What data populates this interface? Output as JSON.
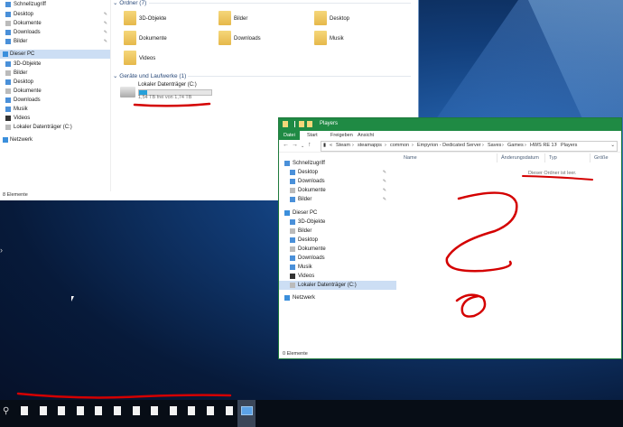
{
  "window1": {
    "nav": {
      "quick_access": "Schnellzugriff",
      "quick_items": [
        "Desktop",
        "Dokumente",
        "Downloads",
        "Bilder"
      ],
      "this_pc": "Dieser PC",
      "pc_items": [
        "3D-Objekte",
        "Bilder",
        "Desktop",
        "Dokumente",
        "Downloads",
        "Musik",
        "Videos",
        "Lokaler Datenträger (C:)"
      ],
      "network": "Netzwerk"
    },
    "folders_header": "Ordner (7)",
    "folders": [
      "3D-Objekte",
      "Bilder",
      "Desktop",
      "Dokumente",
      "Downloads",
      "Musik",
      "Videos"
    ],
    "drives_header": "Geräte und Laufwerke (1)",
    "drive": {
      "name": "Lokaler Datenträger (C:)",
      "free_text": "1,54 TB frei von 1,74 TB",
      "used_fraction": 0.115
    },
    "status": "8 Elemente"
  },
  "window2": {
    "title": "Players",
    "tabs": [
      "Datei",
      "Start",
      "Freigeben",
      "Ansicht"
    ],
    "breadcrumb": [
      "Steam",
      "steamapps",
      "common",
      "Empyrion - Dedicated Server",
      "Saves",
      "Games",
      "HWS RE 17",
      "Players"
    ],
    "nav": {
      "quick_access": "Schnellzugriff",
      "quick_items": [
        "Desktop",
        "Downloads",
        "Dokumente",
        "Bilder"
      ],
      "this_pc": "Dieser PC",
      "pc_items": [
        "3D-Objekte",
        "Bilder",
        "Desktop",
        "Dokumente",
        "Downloads",
        "Musik",
        "Videos",
        "Lokaler Datenträger (C:)"
      ],
      "network": "Netzwerk"
    },
    "columns": [
      "Name",
      "Änderungsdatum",
      "Typ",
      "Größe"
    ],
    "empty_message": "Dieser Ordner ist leer.",
    "status": "0 Elemente"
  },
  "taskbar": {
    "search_icon": "search-icon",
    "item_count": 13
  },
  "colors": {
    "accent_green": "#1f8a44",
    "selection": "#ccdef4",
    "annotation_red": "#d40000"
  }
}
